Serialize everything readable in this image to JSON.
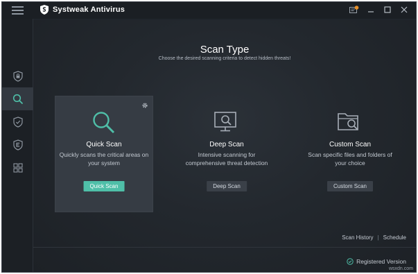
{
  "app": {
    "title": "Systweak Antivirus"
  },
  "sidebar": {
    "items": [
      {
        "icon": "lock-shield-icon",
        "active": false
      },
      {
        "icon": "search-icon",
        "active": true
      },
      {
        "icon": "shield-check-icon",
        "active": false
      },
      {
        "icon": "e-shield-icon",
        "active": false
      },
      {
        "icon": "grid-icon",
        "active": false
      }
    ]
  },
  "header": {
    "title": "Scan Type",
    "subtitle": "Choose the desired scanning criteria to detect hidden threats!"
  },
  "cards": [
    {
      "title": "Quick Scan",
      "desc_line1": "Quickly scans the critical areas on",
      "desc_line2": "your system",
      "button": "Quick Scan",
      "icon": "magnifier-icon"
    },
    {
      "title": "Deep Scan",
      "desc_line1": "Intensive scanning for",
      "desc_line2": "comprehensive threat detection",
      "button": "Deep Scan",
      "icon": "monitor-search-icon"
    },
    {
      "title": "Custom Scan",
      "desc_line1": "Scan specific files and folders of",
      "desc_line2": "your choice",
      "button": "Custom Scan",
      "icon": "folder-search-icon"
    }
  ],
  "footer": {
    "scan_history": "Scan History",
    "separator": "|",
    "schedule": "Schedule",
    "registered": "Registered Version",
    "watermark": "wsxdn.com"
  },
  "colors": {
    "accent": "#4fbfa8",
    "background": "#20252c",
    "notification": "#e8912a"
  }
}
